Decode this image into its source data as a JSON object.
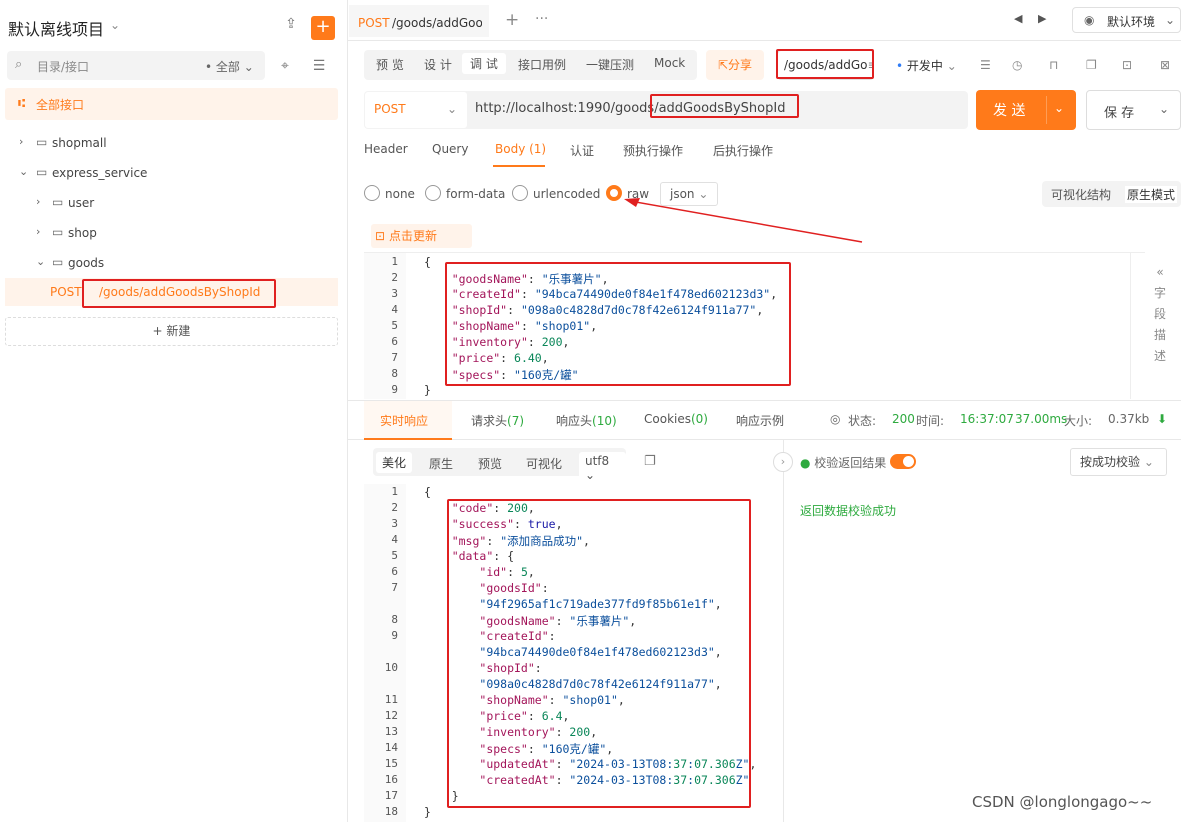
{
  "sidebar": {
    "project_title": "默认离线项目",
    "search_placeholder": "目录/接口",
    "filter_label": "全部",
    "all_apis_label": "全部接口",
    "tree": [
      {
        "label": "shopmall"
      },
      {
        "label": "express_service"
      },
      {
        "label": "user"
      },
      {
        "label": "shop"
      },
      {
        "label": "goods"
      }
    ],
    "selected_api": {
      "method": "POST",
      "path": "/goods/addGoodsByShopId"
    },
    "new_button": "新建"
  },
  "top_tabs": {
    "active_method": "POST",
    "active_path": "/goods/addGoo",
    "environment": "默认环境"
  },
  "mode_tabs": [
    "预 览",
    "设 计",
    "调 试",
    "接口用例",
    "一键压测",
    "Mock"
  ],
  "share_label": "分享",
  "path_field": "/goods/addGo",
  "env_status": "开发中",
  "request": {
    "method": "POST",
    "url": "http://localhost:1990/goods/addGoodsByShopId",
    "send_label": "发 送",
    "save_label": "保 存"
  },
  "request_tabs": [
    "Header",
    "Query",
    "Body (1)",
    "认证",
    "预执行操作",
    "后执行操作"
  ],
  "body_types": [
    "none",
    "form-data",
    "urlencoded",
    "raw"
  ],
  "json_select": "json",
  "view_modes": [
    "可视化结构",
    "原生模式"
  ],
  "refresh_label": "点击更新",
  "field_desc": [
    "字",
    "段",
    "描",
    "述"
  ],
  "body_lines": [
    {
      "n": "1",
      "t": "{"
    },
    {
      "n": "2",
      "t": "    \"goodsName\": \"乐事薯片\","
    },
    {
      "n": "3",
      "t": "    \"createId\": \"94bca74490de0f84e1f478ed602123d3\","
    },
    {
      "n": "4",
      "t": "    \"shopId\": \"098a0c4828d7d0c78f42e6124f911a77\","
    },
    {
      "n": "5",
      "t": "    \"shopName\": \"shop01\","
    },
    {
      "n": "6",
      "t": "    \"inventory\": 200,"
    },
    {
      "n": "7",
      "t": "    \"price\": 6.40,"
    },
    {
      "n": "8",
      "t": "    \"specs\": \"160克/罐\""
    },
    {
      "n": "9",
      "t": "}"
    }
  ],
  "response_tabs": {
    "realtime": "实时响应",
    "req_headers": "请求头",
    "req_headers_count": "(7)",
    "resp_headers": "响应头",
    "resp_headers_count": "(10)",
    "cookies": "Cookies",
    "cookies_count": "(0)",
    "example": "响应示例"
  },
  "status": {
    "status_label": "状态:",
    "status_value": "200",
    "time_label": "时间:",
    "time_value": "16:37:07",
    "duration": "37.00ms",
    "size_label": "大小:",
    "size_value": "0.37kb"
  },
  "format_tabs": [
    "美化",
    "原生",
    "预览",
    "可视化"
  ],
  "encoding": "utf8",
  "validate_label": "校验返回结果",
  "validate_select": "按成功校验",
  "validate_msg": "返回数据校验成功",
  "response_lines": [
    {
      "n": "1",
      "t": "{"
    },
    {
      "n": "2",
      "t": "    \"code\": 200,"
    },
    {
      "n": "3",
      "t": "    \"success\": true,"
    },
    {
      "n": "4",
      "t": "    \"msg\": \"添加商品成功\","
    },
    {
      "n": "5",
      "t": "    \"data\": {"
    },
    {
      "n": "6",
      "t": "        \"id\": 5,"
    },
    {
      "n": "7",
      "t": "        \"goodsId\":"
    },
    {
      "n": "",
      "t": "        \"94f2965af1c719ade377fd9f85b61e1f\","
    },
    {
      "n": "8",
      "t": "        \"goodsName\": \"乐事薯片\","
    },
    {
      "n": "9",
      "t": "        \"createId\":"
    },
    {
      "n": "",
      "t": "        \"94bca74490de0f84e1f478ed602123d3\","
    },
    {
      "n": "10",
      "t": "        \"shopId\":"
    },
    {
      "n": "",
      "t": "        \"098a0c4828d7d0c78f42e6124f911a77\","
    },
    {
      "n": "11",
      "t": "        \"shopName\": \"shop01\","
    },
    {
      "n": "12",
      "t": "        \"price\": 6.4,"
    },
    {
      "n": "13",
      "t": "        \"inventory\": 200,"
    },
    {
      "n": "14",
      "t": "        \"specs\": \"160克/罐\","
    },
    {
      "n": "15",
      "t": "        \"updatedAt\": \"2024-03-13T08:37:07.306Z\","
    },
    {
      "n": "16",
      "t": "        \"createdAt\": \"2024-03-13T08:37:07.306Z\""
    },
    {
      "n": "17",
      "t": "    }"
    },
    {
      "n": "18",
      "t": "}"
    }
  ],
  "watermark": "CSDN @longlongago~~",
  "colors": {
    "accent": "#ff7a1a",
    "success": "#2eaa3f",
    "highlight_box": "#e02020"
  }
}
